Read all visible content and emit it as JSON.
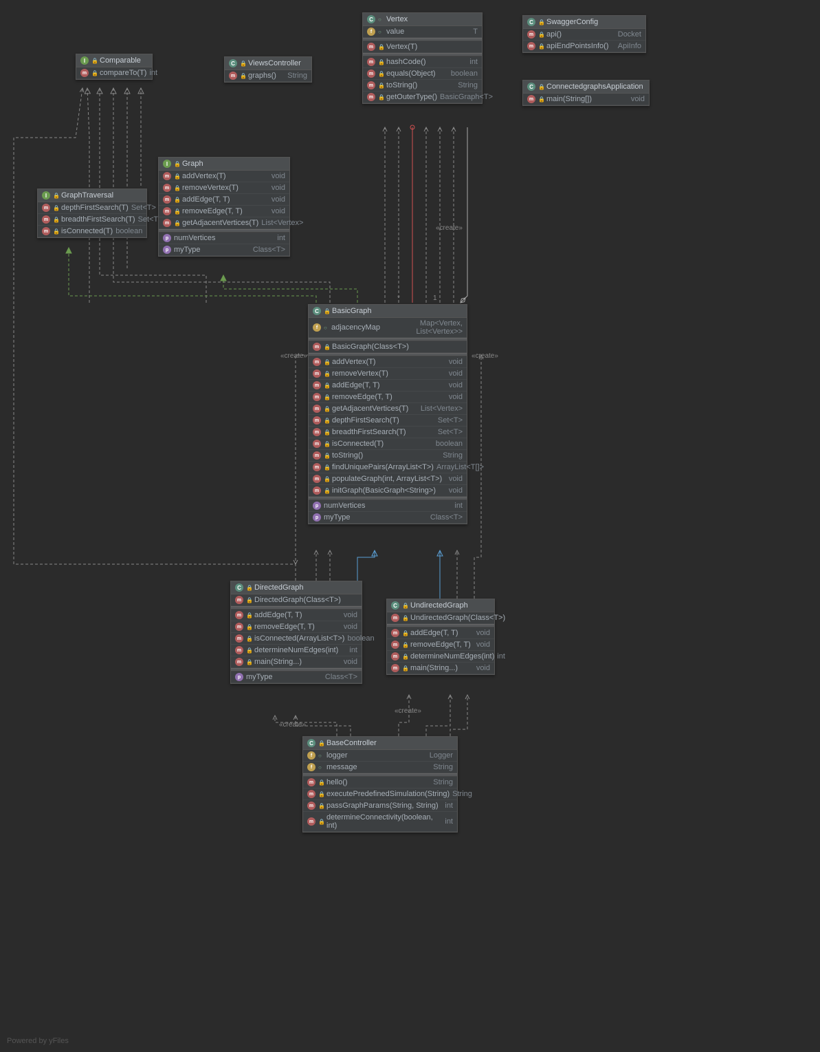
{
  "footer": "Powered by yFiles",
  "stereotypes": {
    "create1": "«create»",
    "create2": "«create»",
    "create3": "«create»",
    "create4": "«create»",
    "create5": "«create»"
  },
  "multiplicity": {
    "one": "1",
    "star": "*"
  },
  "classes": {
    "comparable": {
      "name": "Comparable",
      "members": [
        {
          "kind": "method",
          "vis": "lock",
          "name": "compareTo(T)",
          "type": "int"
        }
      ]
    },
    "viewsController": {
      "name": "ViewsController",
      "members": [
        {
          "kind": "method",
          "vis": "lock",
          "name": "graphs()",
          "type": "String"
        }
      ]
    },
    "vertex": {
      "name": "Vertex",
      "fields": [
        {
          "kind": "field",
          "vis": "open",
          "name": "value",
          "type": "T"
        }
      ],
      "ctor": [
        {
          "kind": "method",
          "vis": "lock",
          "name": "Vertex(T)",
          "type": ""
        }
      ],
      "members": [
        {
          "kind": "method",
          "vis": "lock",
          "name": "hashCode()",
          "type": "int"
        },
        {
          "kind": "method",
          "vis": "lock",
          "name": "equals(Object)",
          "type": "boolean"
        },
        {
          "kind": "method",
          "vis": "lock",
          "name": "toString()",
          "type": "String"
        },
        {
          "kind": "method",
          "vis": "lock",
          "name": "getOuterType()",
          "type": "BasicGraph<T>"
        }
      ]
    },
    "swaggerConfig": {
      "name": "SwaggerConfig",
      "members": [
        {
          "kind": "method",
          "vis": "lock",
          "name": "api()",
          "type": "Docket"
        },
        {
          "kind": "method",
          "vis": "lock",
          "name": "apiEndPointsInfo()",
          "type": "ApiInfo"
        }
      ]
    },
    "connectedgraphs": {
      "name": "ConnectedgraphsApplication",
      "members": [
        {
          "kind": "method",
          "vis": "lock",
          "name": "main(String[])",
          "type": "void"
        }
      ]
    },
    "graphTraversal": {
      "name": "GraphTraversal",
      "members": [
        {
          "kind": "method",
          "vis": "lock",
          "name": "depthFirstSearch(T)",
          "type": "Set<T>"
        },
        {
          "kind": "method",
          "vis": "lock",
          "name": "breadthFirstSearch(T)",
          "type": "Set<T>"
        },
        {
          "kind": "method",
          "vis": "lock",
          "name": "isConnected(T)",
          "type": "boolean"
        }
      ]
    },
    "graph": {
      "name": "Graph",
      "members": [
        {
          "kind": "method",
          "vis": "lock",
          "name": "addVertex(T)",
          "type": "void"
        },
        {
          "kind": "method",
          "vis": "lock",
          "name": "removeVertex(T)",
          "type": "void"
        },
        {
          "kind": "method",
          "vis": "lock",
          "name": "addEdge(T, T)",
          "type": "void"
        },
        {
          "kind": "method",
          "vis": "lock",
          "name": "removeEdge(T, T)",
          "type": "void"
        },
        {
          "kind": "method",
          "vis": "lock",
          "name": "getAdjacentVertices(T)",
          "type": "List<Vertex>"
        }
      ],
      "props": [
        {
          "kind": "prop",
          "vis": "",
          "name": "numVertices",
          "type": "int"
        },
        {
          "kind": "prop",
          "vis": "",
          "name": "myType",
          "type": "Class<T>"
        }
      ]
    },
    "basicGraph": {
      "name": "BasicGraph",
      "fields": [
        {
          "kind": "field",
          "vis": "open",
          "name": "adjacencyMap",
          "type": "Map<Vertex, List<Vertex>>"
        }
      ],
      "ctor": [
        {
          "kind": "method",
          "vis": "lock",
          "name": "BasicGraph(Class<T>)",
          "type": ""
        }
      ],
      "members": [
        {
          "kind": "method",
          "vis": "lock",
          "name": "addVertex(T)",
          "type": "void"
        },
        {
          "kind": "method",
          "vis": "lock",
          "name": "removeVertex(T)",
          "type": "void"
        },
        {
          "kind": "method",
          "vis": "lock",
          "name": "addEdge(T, T)",
          "type": "void"
        },
        {
          "kind": "method",
          "vis": "lock",
          "name": "removeEdge(T, T)",
          "type": "void"
        },
        {
          "kind": "method",
          "vis": "lock",
          "name": "getAdjacentVertices(T)",
          "type": "List<Vertex>"
        },
        {
          "kind": "method",
          "vis": "lock",
          "name": "depthFirstSearch(T)",
          "type": "Set<T>"
        },
        {
          "kind": "method",
          "vis": "lock",
          "name": "breadthFirstSearch(T)",
          "type": "Set<T>"
        },
        {
          "kind": "method",
          "vis": "lock",
          "name": "isConnected(T)",
          "type": "boolean"
        },
        {
          "kind": "method",
          "vis": "lock",
          "name": "toString()",
          "type": "String"
        },
        {
          "kind": "method",
          "vis": "lock",
          "name": "findUniquePairs(ArrayList<T>)",
          "type": "ArrayList<T[]>"
        },
        {
          "kind": "method",
          "vis": "lock",
          "name": "populateGraph(int, ArrayList<T>)",
          "type": "void"
        },
        {
          "kind": "method",
          "vis": "lock",
          "name": "initGraph(BasicGraph<String>)",
          "type": "void"
        }
      ],
      "props": [
        {
          "kind": "prop",
          "vis": "",
          "name": "numVertices",
          "type": "int"
        },
        {
          "kind": "prop",
          "vis": "",
          "name": "myType",
          "type": "Class<T>"
        }
      ]
    },
    "directedGraph": {
      "name": "DirectedGraph",
      "ctor": [
        {
          "kind": "method",
          "vis": "lock",
          "name": "DirectedGraph(Class<T>)",
          "type": ""
        }
      ],
      "members": [
        {
          "kind": "method",
          "vis": "lock",
          "name": "addEdge(T, T)",
          "type": "void"
        },
        {
          "kind": "method",
          "vis": "lock",
          "name": "removeEdge(T, T)",
          "type": "void"
        },
        {
          "kind": "method",
          "vis": "lock",
          "name": "isConnected(ArrayList<T>)",
          "type": "boolean"
        },
        {
          "kind": "method",
          "vis": "lock",
          "name": "determineNumEdges(int)",
          "type": "int"
        },
        {
          "kind": "method",
          "vis": "lock",
          "name": "main(String...)",
          "type": "void"
        }
      ],
      "props": [
        {
          "kind": "prop",
          "vis": "",
          "name": "myType",
          "type": "Class<T>"
        }
      ]
    },
    "undirectedGraph": {
      "name": "UndirectedGraph",
      "ctor": [
        {
          "kind": "method",
          "vis": "lock",
          "name": "UndirectedGraph(Class<T>)",
          "type": ""
        }
      ],
      "members": [
        {
          "kind": "method",
          "vis": "lock",
          "name": "addEdge(T, T)",
          "type": "void"
        },
        {
          "kind": "method",
          "vis": "lock",
          "name": "removeEdge(T, T)",
          "type": "void"
        },
        {
          "kind": "method",
          "vis": "lock",
          "name": "determineNumEdges(int)",
          "type": "int"
        },
        {
          "kind": "method",
          "vis": "lock",
          "name": "main(String...)",
          "type": "void"
        }
      ]
    },
    "baseController": {
      "name": "BaseController",
      "fields": [
        {
          "kind": "field",
          "vis": "open",
          "name": "logger",
          "type": "Logger"
        },
        {
          "kind": "field",
          "vis": "open",
          "name": "message",
          "type": "String"
        }
      ],
      "members": [
        {
          "kind": "method",
          "vis": "lock",
          "name": "hello()",
          "type": "String"
        },
        {
          "kind": "method",
          "vis": "lock",
          "name": "executePredefinedSimulation(String)",
          "type": "String"
        },
        {
          "kind": "method",
          "vis": "lock",
          "name": "passGraphParams(String, String)",
          "type": "int"
        },
        {
          "kind": "method",
          "vis": "lock",
          "name": "determineConnectivity(boolean, int)",
          "type": "int"
        }
      ]
    }
  }
}
